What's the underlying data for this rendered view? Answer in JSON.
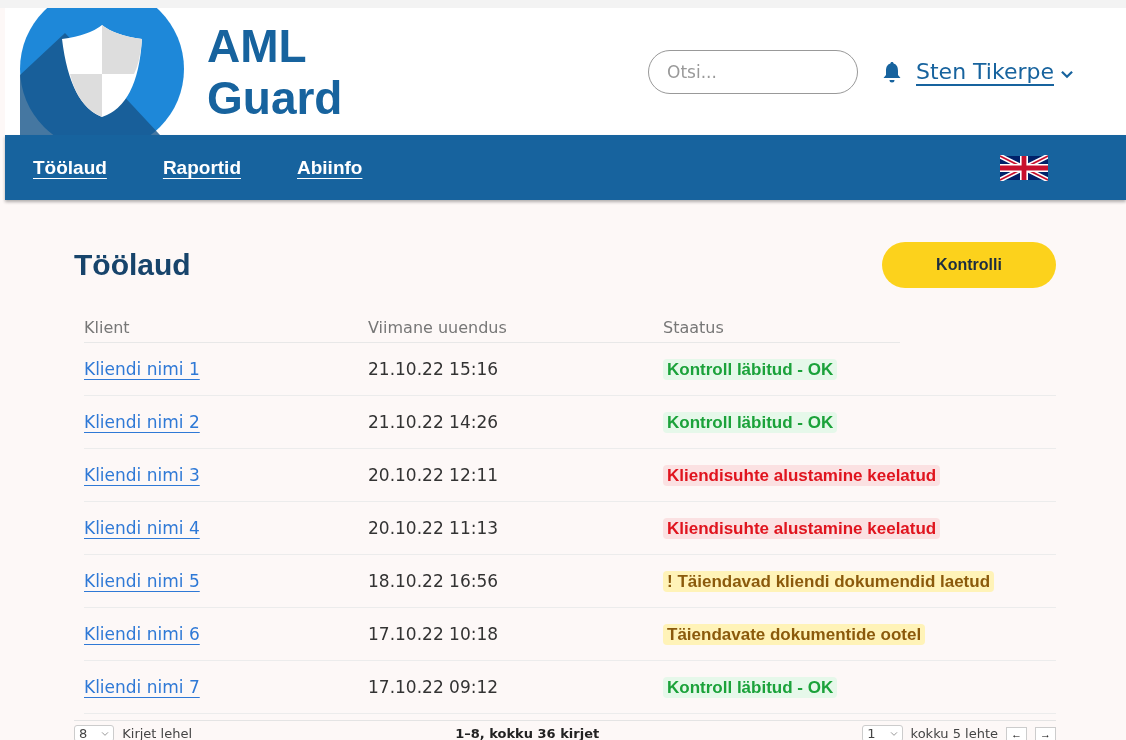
{
  "brand": {
    "line_1": "AML",
    "line_2": "Guard"
  },
  "search": {
    "placeholder": "Otsi..."
  },
  "user": {
    "name": "Sten Tikerpe"
  },
  "nav": [
    "Töölaud",
    "Raportid",
    "Abiinfo"
  ],
  "page": {
    "title": "Töölaud",
    "action": "Kontrolli"
  },
  "table": {
    "columns": [
      "Klient",
      "Viimane uuendus",
      "Staatus"
    ],
    "rows": [
      {
        "client": "Kliendi nimi 1",
        "updated": "21.10.22 15:16",
        "status": "Kontroll läbitud - OK",
        "kind": "ok"
      },
      {
        "client": "Kliendi nimi 2",
        "updated": "21.10.22 14:26",
        "status": "Kontroll läbitud - OK",
        "kind": "ok"
      },
      {
        "client": "Kliendi nimi 3",
        "updated": "20.10.22 12:11",
        "status": "Kliendisuhte alustamine keelatud",
        "kind": "denied"
      },
      {
        "client": "Kliendi nimi 4",
        "updated": "20.10.22 11:13",
        "status": "Kliendisuhte alustamine keelatud",
        "kind": "denied"
      },
      {
        "client": "Kliendi nimi 5",
        "updated": "18.10.22 16:56",
        "status": "! Täiendavad kliendi dokumendid  laetud",
        "kind": "pending"
      },
      {
        "client": "Kliendi nimi 6",
        "updated": "17.10.22 10:18",
        "status": "Täiendavate dokumentide ootel",
        "kind": "pending"
      },
      {
        "client": "Kliendi nimi 7",
        "updated": "17.10.22 09:12",
        "status": "Kontroll läbitud - OK",
        "kind": "ok"
      }
    ]
  },
  "pagination": {
    "page_size": "8",
    "page_size_label": "Kirjet lehel",
    "range": "1–8, kokku 36 kirjet",
    "page": "1",
    "pages_label": "kokku 5 lehte",
    "prev": "←",
    "next": "→"
  }
}
